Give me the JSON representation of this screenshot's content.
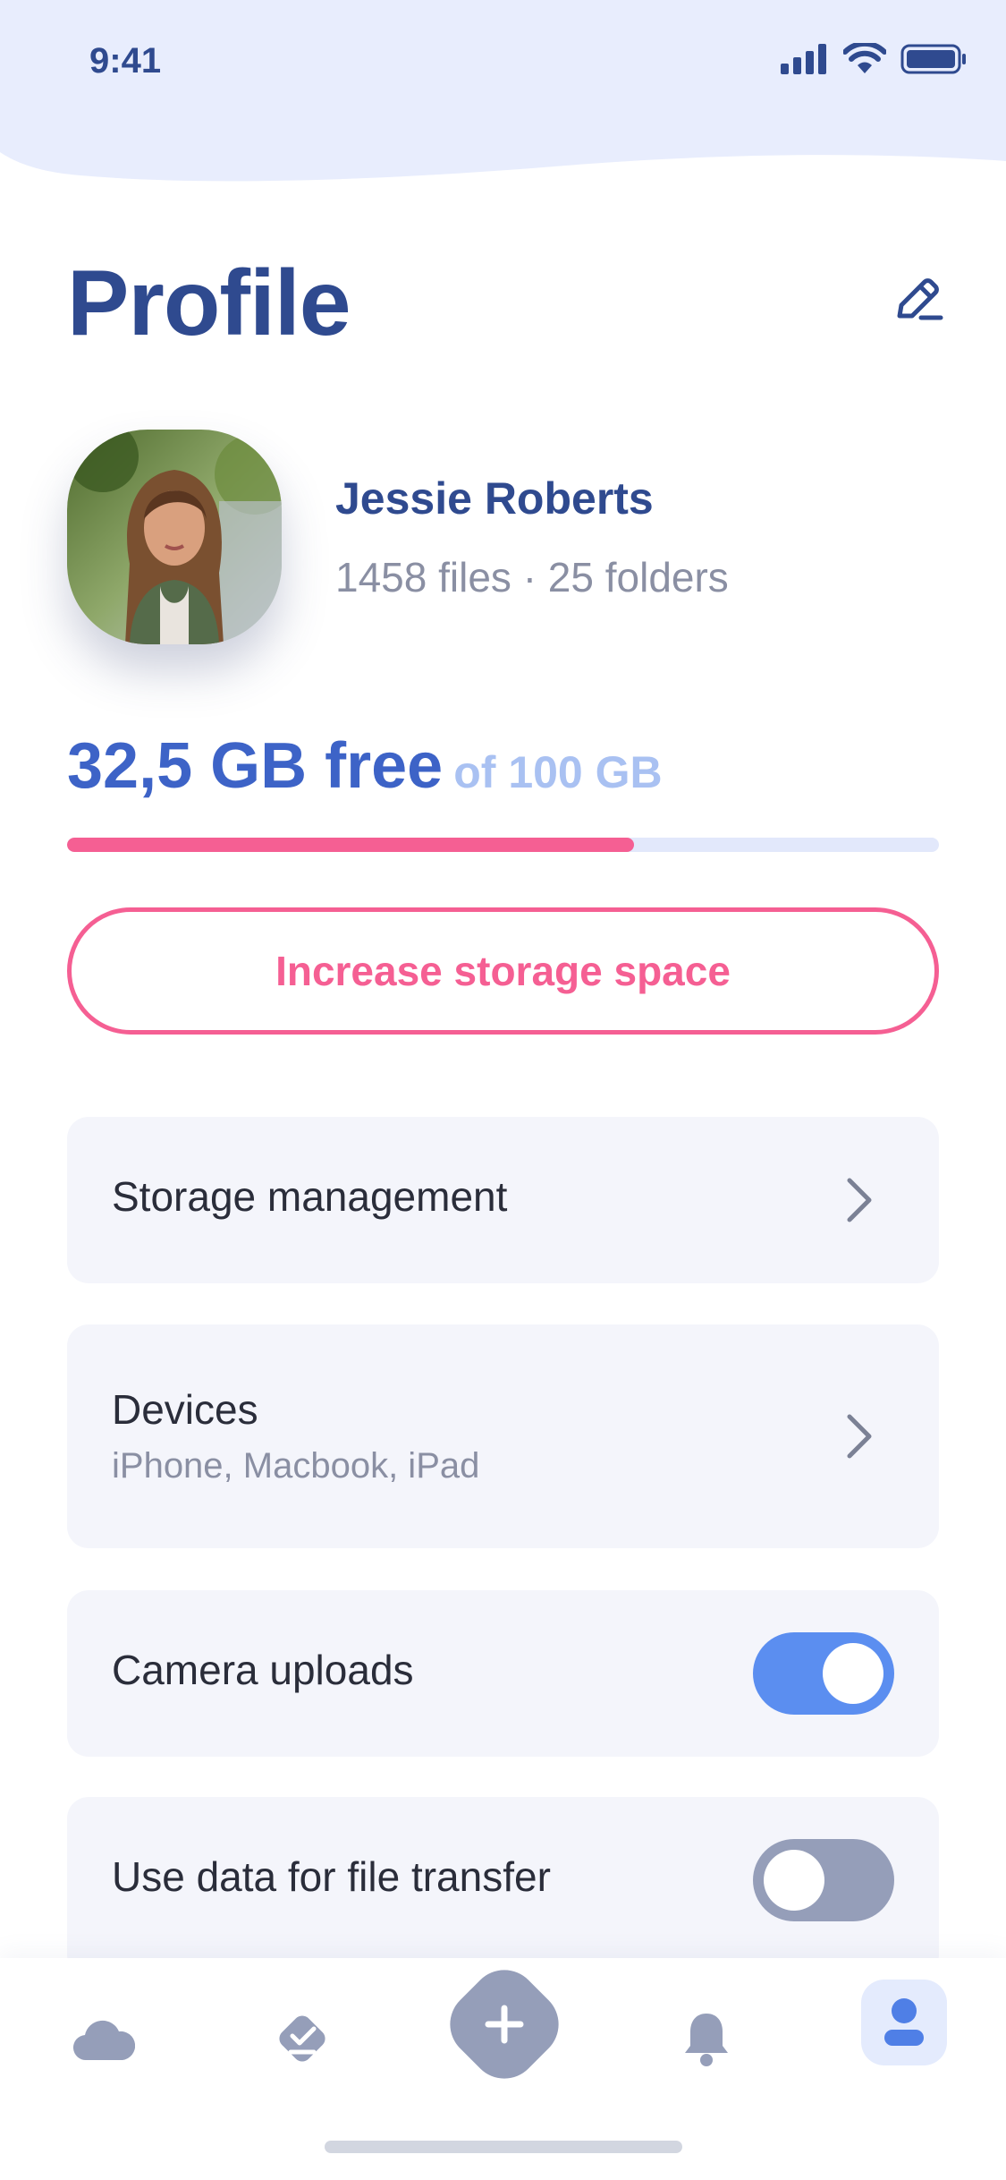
{
  "status_bar": {
    "time": "9:41",
    "icons": [
      "signal-icon",
      "wifi-icon",
      "battery-icon"
    ]
  },
  "header": {
    "title": "Profile",
    "edit_icon": "pencil-icon"
  },
  "profile": {
    "name": "Jessie Roberts",
    "meta": "1458 files · 25 folders",
    "avatar": "user-photo"
  },
  "storage": {
    "free": "32,5 GB free",
    "total": "of 100 GB",
    "used_fraction": 0.65,
    "button_label": "Increase storage space"
  },
  "settings": {
    "storage_management": {
      "title": "Storage management"
    },
    "devices": {
      "title": "Devices",
      "subtitle": "iPhone, Macbook, iPad"
    },
    "camera_uploads": {
      "title": "Camera uploads",
      "enabled": true
    },
    "data_transfer": {
      "title": "Use data for file transfer",
      "enabled": false
    }
  },
  "tabbar": {
    "items": [
      "cloud-icon",
      "tasks-icon",
      "add-icon",
      "bell-icon",
      "profile-icon"
    ],
    "active": "profile-icon"
  },
  "colors": {
    "primary": "#2f4a8f",
    "accent_blue": "#3d63c7",
    "pink": "#f55f93",
    "toggle_on": "#5b8ef0",
    "toggle_off": "#959eb9"
  }
}
